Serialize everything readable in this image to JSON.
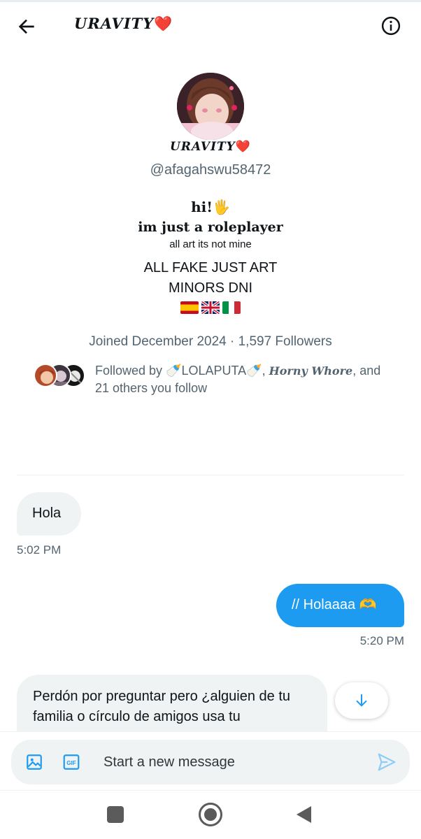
{
  "header": {
    "title": "URAVITY",
    "title_heart": "❤️",
    "back_icon": "arrow-left-icon",
    "info_icon": "info-circle-icon"
  },
  "profile": {
    "display_name": "URAVITY",
    "display_name_heart": "❤️",
    "handle": "@afagahswu58472",
    "bio": {
      "line1": "hi!🖐",
      "line2": "im just a roleplayer",
      "line3": "all art its not mine",
      "line4": "ALL FAKE JUST ART",
      "line5": "MINORS DNI",
      "flags": [
        "spain-flag",
        "uk-flag",
        "italy-flag"
      ]
    },
    "joined": "Joined December 2024",
    "separator": " · ",
    "followers": "1,597 Followers",
    "followed_by": {
      "prefix": "Followed by ",
      "name1": "🍼LOLAPUTA🍼",
      "sep1": ", ",
      "name2": "Horny Whore",
      "sep2": ", and",
      "rest": "21 others you follow"
    }
  },
  "messages": [
    {
      "direction": "incoming",
      "text": "Hola",
      "time": "5:02 PM"
    },
    {
      "direction": "outgoing",
      "text": "// Holaaaa 🫶",
      "time": "5:20 PM"
    },
    {
      "direction": "incoming",
      "text": "Perdón por preguntar pero ¿alguien de tu familia o círculo de amigos usa tu"
    }
  ],
  "scroll_down_icon": "arrow-down-icon",
  "composer": {
    "placeholder": "Start a new message",
    "image_icon": "image-icon",
    "gif_icon": "gif-icon",
    "gif_label": "GIF",
    "send_icon": "send-icon"
  },
  "colors": {
    "accent": "#1d9bf0",
    "bubble_incoming": "#eff3f4",
    "secondary_text": "#536471",
    "heart": "#e0245e"
  }
}
